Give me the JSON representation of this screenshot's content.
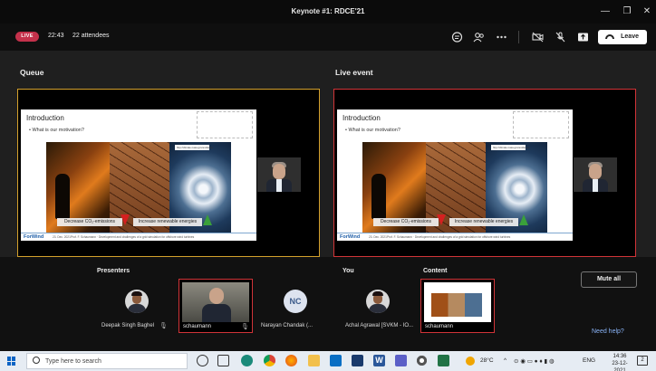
{
  "window": {
    "title": "Keynote #1: RDCE'21",
    "minimize": "—",
    "maximize": "❐",
    "close": "✕"
  },
  "meeting": {
    "live_badge": "LIVE",
    "elapsed": "22:43",
    "attendees": "22 attendees",
    "leave_label": "Leave"
  },
  "stages": {
    "queue_label": "Queue",
    "live_label": "Live event",
    "slide": {
      "title": "Introduction",
      "bullet": "• What is our motivation?",
      "storm_caption": "http://climate.nasa.gov/evidence",
      "co2_label": "Decrease CO₂-emissions",
      "renewable_label": "Increase renewable energies",
      "footer_logo": "ForWind",
      "footer_date": "23. Dec. 2021",
      "footer_text": "Prof. F. Schaumann · Development and challenges of a grid simulation for offshore wind turbines"
    }
  },
  "participants": {
    "presenters_label": "Presenters",
    "you_label": "You",
    "content_label": "Content",
    "presenter1": {
      "initials": "",
      "name": "Deepak Singh Baghel"
    },
    "presenter2": {
      "name": "schaumann"
    },
    "presenter3": {
      "initials": "NC",
      "name": "Narayan Chandak (..."
    },
    "you": {
      "name": "Achal Agrawal [SVKM - IO..."
    },
    "content": {
      "name": "schaumann"
    },
    "mute_all_label": "Mute all",
    "help_label": "Need help?"
  },
  "taskbar": {
    "search_placeholder": "Type here to search",
    "weather": "28°C",
    "language": "ENG",
    "time": "14:36",
    "date": "23-12-2021",
    "notification_count": "2"
  },
  "colors": {
    "live_red": "#c4314b",
    "queue_border": "#d3a02c",
    "live_border": "#d13438",
    "link_blue": "#8ab4f8"
  }
}
